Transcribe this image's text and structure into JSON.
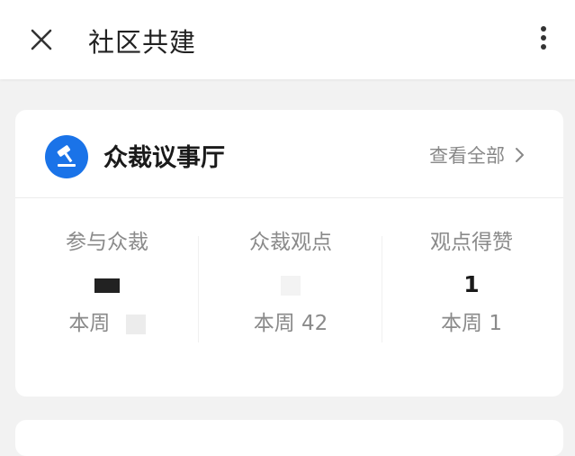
{
  "header": {
    "title": "社区共建",
    "close_icon": "close-icon",
    "more_icon": "more-vertical-icon"
  },
  "hall": {
    "title": "众裁议事厅",
    "icon": "gavel-icon",
    "icon_color": "#1a73e8",
    "view_all": "查看全部"
  },
  "stats": [
    {
      "label": "参与众裁",
      "value": "",
      "week": "本周"
    },
    {
      "label": "众裁观点",
      "value": "",
      "week": "本周 42"
    },
    {
      "label": "观点得赞",
      "value": "1",
      "week": "本周 1"
    }
  ]
}
